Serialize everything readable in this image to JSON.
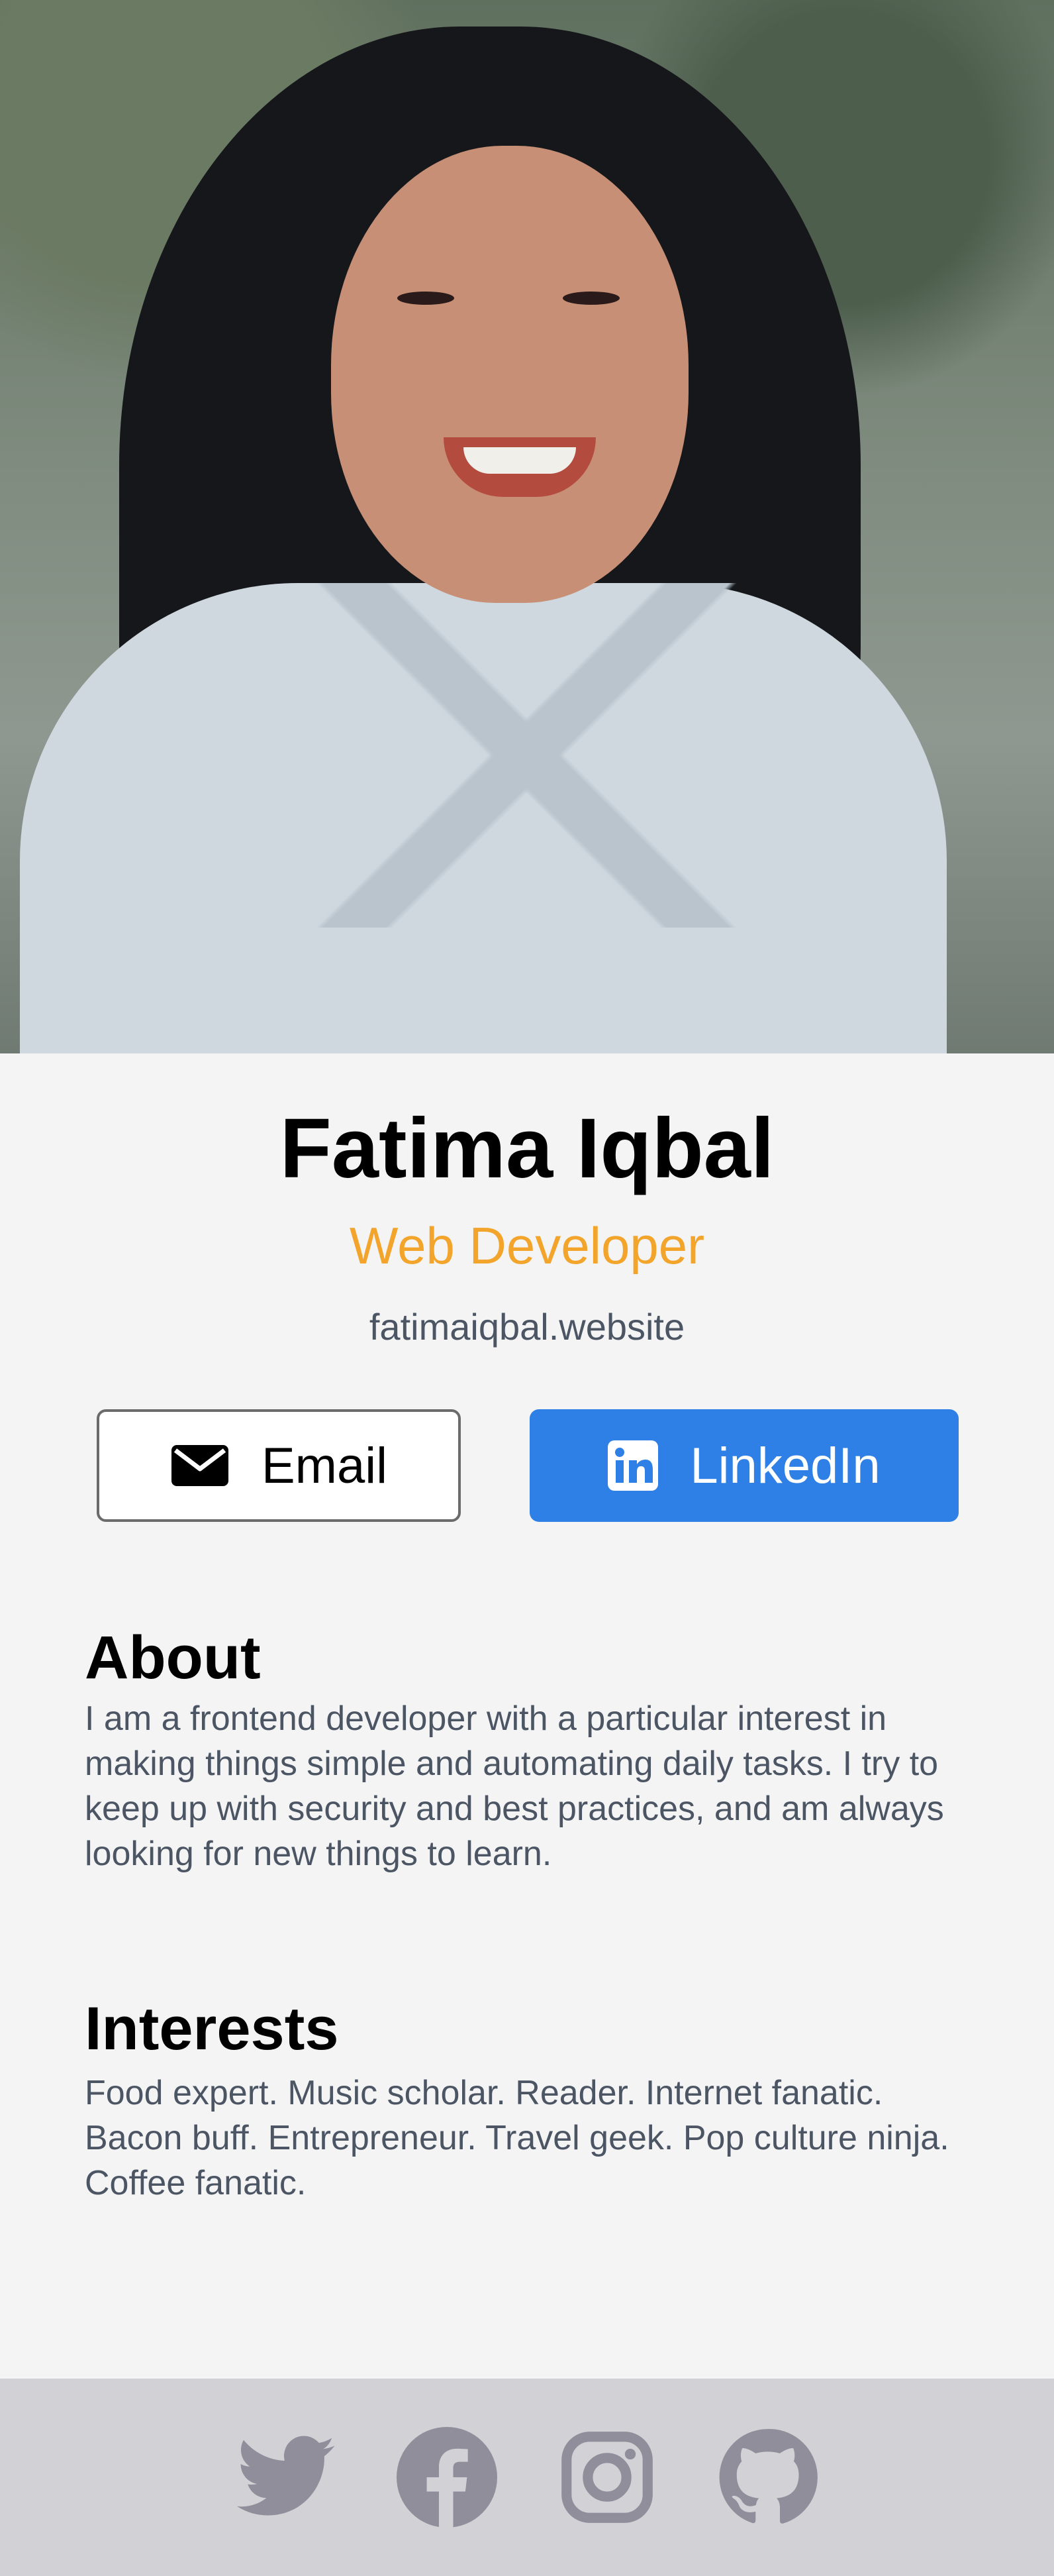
{
  "profile": {
    "name": "Fatima Iqbal",
    "title": "Web Developer",
    "website": "fatimaiqbal.website",
    "title_color": "#f3a42b"
  },
  "actions": {
    "email_label": "Email",
    "linkedin_label": "LinkedIn",
    "email_icon": "envelope-icon",
    "linkedin_icon": "linkedin-icon",
    "linkedin_color": "#2f80e6"
  },
  "about": {
    "heading": "About",
    "text": "I am a frontend developer with a particular interest in making things simple and automating daily tasks. I try to keep up with security and best practices, and am always looking for new things to learn."
  },
  "interests": {
    "heading": "Interests",
    "text": "Food expert. Music scholar. Reader. Internet fanatic. Bacon buff. Entrepreneur. Travel geek. Pop culture ninja. Coffee fanatic."
  },
  "footer": {
    "icons": [
      "twitter-icon",
      "facebook-icon",
      "instagram-icon",
      "github-icon"
    ],
    "icon_color": "#918e9b",
    "background": "#d1d1d6"
  }
}
